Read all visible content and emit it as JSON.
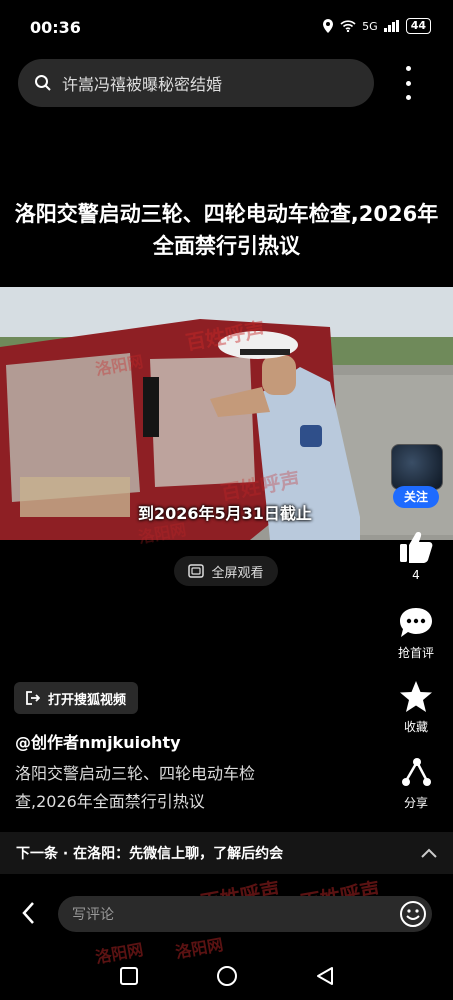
{
  "status_bar": {
    "time": "00:36",
    "network": "5G",
    "battery": "44"
  },
  "search": {
    "query": "许嵩冯禧被曝秘密结婚"
  },
  "video": {
    "title": "洛阳交警启动三轮、四轮电动车检查,2026年全面禁行引热议",
    "subtitle": "到2026年5月31日截止",
    "follow_label": "关注",
    "fullscreen_label": "全屏观看"
  },
  "actions": {
    "like_count": "4",
    "comment_label": "抢首评",
    "favorite_label": "收藏",
    "share_label": "分享"
  },
  "open_app_label": "打开搜狐视频",
  "author": "@创作者nmjkuiohty",
  "description": "洛阳交警启动三轮、四轮电动车检查,2026年全面禁行引热议",
  "next_bar": {
    "text": "下一条 · 在洛阳：先微信上聊，了解后约会"
  },
  "comment_bar": {
    "placeholder": "写评论"
  },
  "watermark": {
    "text": "百姓呼声",
    "site": "洛阳网"
  },
  "icons": {
    "search": "search-icon",
    "more": "more-icon",
    "like": "thumbs-up-icon",
    "comment": "comment-icon",
    "favorite": "star-icon",
    "share": "share-icon",
    "fullscreen": "fullscreen-icon",
    "open_app": "open-app-icon",
    "chevron": "chevron-up-icon",
    "back": "back-icon",
    "emoji": "emoji-icon",
    "nav_recent": "square-icon",
    "nav_home": "circle-icon",
    "nav_back": "triangle-icon"
  },
  "colors": {
    "background": "#000000",
    "accent": "#1e6bff",
    "watermark": "#c82828"
  }
}
